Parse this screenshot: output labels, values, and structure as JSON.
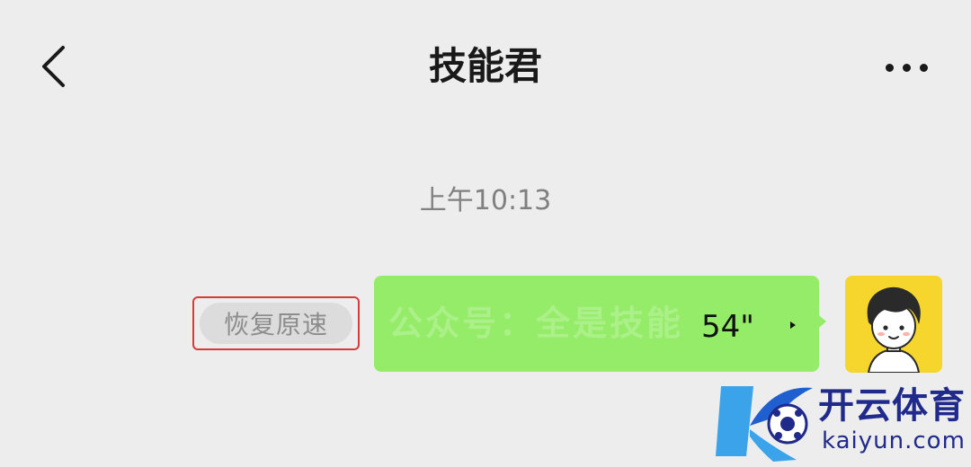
{
  "header": {
    "title": "技能君",
    "back_icon": "chevron-left-icon",
    "more_icon": "more-dots-icon"
  },
  "chat": {
    "timestamp": "上午10:13",
    "message": {
      "type": "voice",
      "duration": "54\"",
      "bubble_color": "#95ec69",
      "restore_speed_label": "恢复原速",
      "highlight_color": "#d93a3a"
    },
    "watermark": "公众号：全是技能"
  },
  "logo": {
    "cn": "开云体育",
    "en": "kaiyun.com"
  }
}
